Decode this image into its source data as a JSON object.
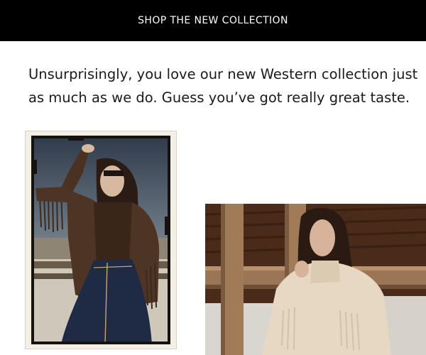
{
  "banner": {
    "label": "SHOP THE NEW COLLECTION"
  },
  "intro": {
    "line1": "Unsurprisingly, you love our new Western collection just",
    "line2": "as much as we do. Guess you’ve got really great taste."
  },
  "colors": {
    "banner_bg": "#000000",
    "banner_text": "#ffffff",
    "body_text": "#1a1a1a"
  }
}
